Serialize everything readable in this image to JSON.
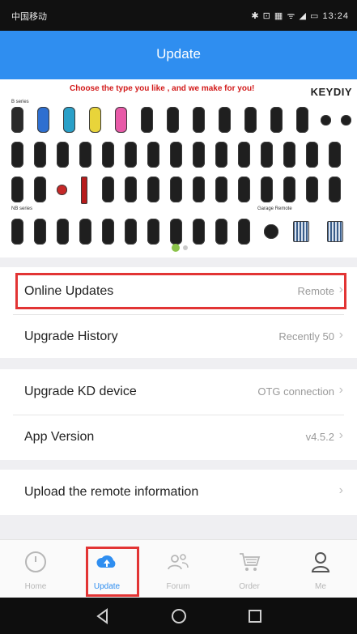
{
  "status_bar": {
    "carrier": "中国移动",
    "indicators": "✱ ⊡ ▦ ᯤ ◢ ▭",
    "time": "13:24"
  },
  "app_bar": {
    "title": "Update"
  },
  "banner": {
    "tagline": "Choose the type you like , and we make for you!",
    "brand": "KEYDIY",
    "caption_1": "B series",
    "caption_2": "NB series",
    "caption_3": "Garage Remote"
  },
  "list": {
    "online_updates": {
      "label": "Online Updates",
      "value": "Remote"
    },
    "upgrade_history": {
      "label": "Upgrade History",
      "value": "Recently 50"
    },
    "upgrade_kd_device": {
      "label": "Upgrade KD device",
      "value": "OTG connection"
    },
    "app_version": {
      "label": "App Version",
      "value": "v4.5.2"
    },
    "upload_remote_info": {
      "label": "Upload the remote information",
      "value": ""
    }
  },
  "tabs": [
    {
      "label": "Home",
      "icon": "gauge-icon"
    },
    {
      "label": "Update",
      "icon": "cloud-upload-icon"
    },
    {
      "label": "Forum",
      "icon": "people-icon"
    },
    {
      "label": "Order",
      "icon": "cart-icon"
    },
    {
      "label": "Me",
      "icon": "person-icon"
    }
  ],
  "nav": {
    "back_icon": "back-triangle-icon",
    "home_icon": "home-circle-icon",
    "recents_icon": "recents-square-icon"
  },
  "colors": {
    "accent": "#2f8ef0",
    "highlight": "#e23434"
  }
}
